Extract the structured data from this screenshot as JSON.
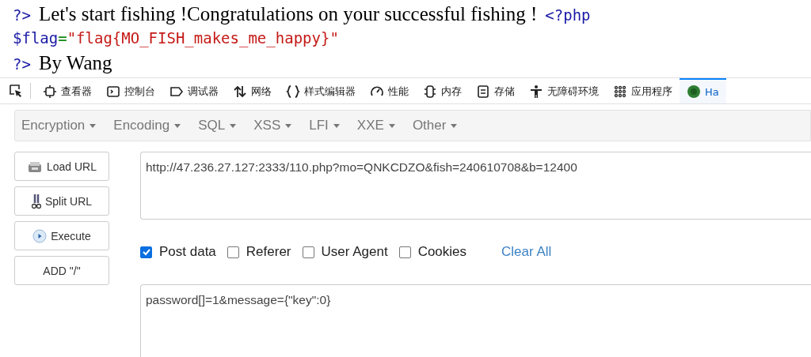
{
  "page_output": [
    [
      {
        "kind": "php",
        "text": "?>"
      },
      {
        "kind": "text",
        "text": "Let's start fishing !Congratulations on your successful fishing !"
      },
      {
        "kind": "php",
        "text": "<?php"
      }
    ],
    [
      {
        "kind": "php",
        "text": "$flag"
      },
      {
        "kind": "operator",
        "text": "="
      },
      {
        "kind": "string",
        "text": "\"flag{MO_FISH_makes_me_happy}\""
      }
    ],
    [
      {
        "kind": "php",
        "text": "?>"
      },
      {
        "kind": "text",
        "text": "By Wang"
      }
    ]
  ],
  "devtools_tabs": [
    {
      "kind": "inspector",
      "label": "查看器",
      "selected": false
    },
    {
      "kind": "console",
      "label": "控制台",
      "selected": false
    },
    {
      "kind": "debugger",
      "label": "调试器",
      "selected": false
    },
    {
      "kind": "network",
      "label": "网络",
      "selected": false
    },
    {
      "kind": "style",
      "label": "样式编辑器",
      "selected": false
    },
    {
      "kind": "performance",
      "label": "性能",
      "selected": false
    },
    {
      "kind": "memory",
      "label": "内存",
      "selected": false
    },
    {
      "kind": "storage",
      "label": "存储",
      "selected": false
    },
    {
      "kind": "accessibility",
      "label": "无障碍环境",
      "selected": false
    },
    {
      "kind": "application",
      "label": "应用程序",
      "selected": false
    },
    {
      "kind": "hackbar",
      "label": "Ha",
      "selected": true
    }
  ],
  "hackbar_menu": [
    "Encryption",
    "Encoding",
    "SQL",
    "XSS",
    "LFI",
    "XXE",
    "Other"
  ],
  "action_buttons": [
    {
      "kind": "load",
      "label": "Load URL"
    },
    {
      "kind": "split",
      "label": "Split URL"
    },
    {
      "kind": "execute",
      "label": "Execute"
    },
    {
      "kind": "plain",
      "label": "ADD \"/\""
    }
  ],
  "url_field": {
    "value": "http://47.236.27.127:2333/110.php?mo=QNKCDZO&fish=240610708&b=12400"
  },
  "options": [
    {
      "label": "Post data",
      "checked": true
    },
    {
      "label": "Referer",
      "checked": false
    },
    {
      "label": "User Agent",
      "checked": false
    },
    {
      "label": "Cookies",
      "checked": false
    }
  ],
  "clear_all": "Clear All",
  "post_field": {
    "value": "password[]=1&message={\"key\":0}"
  }
}
